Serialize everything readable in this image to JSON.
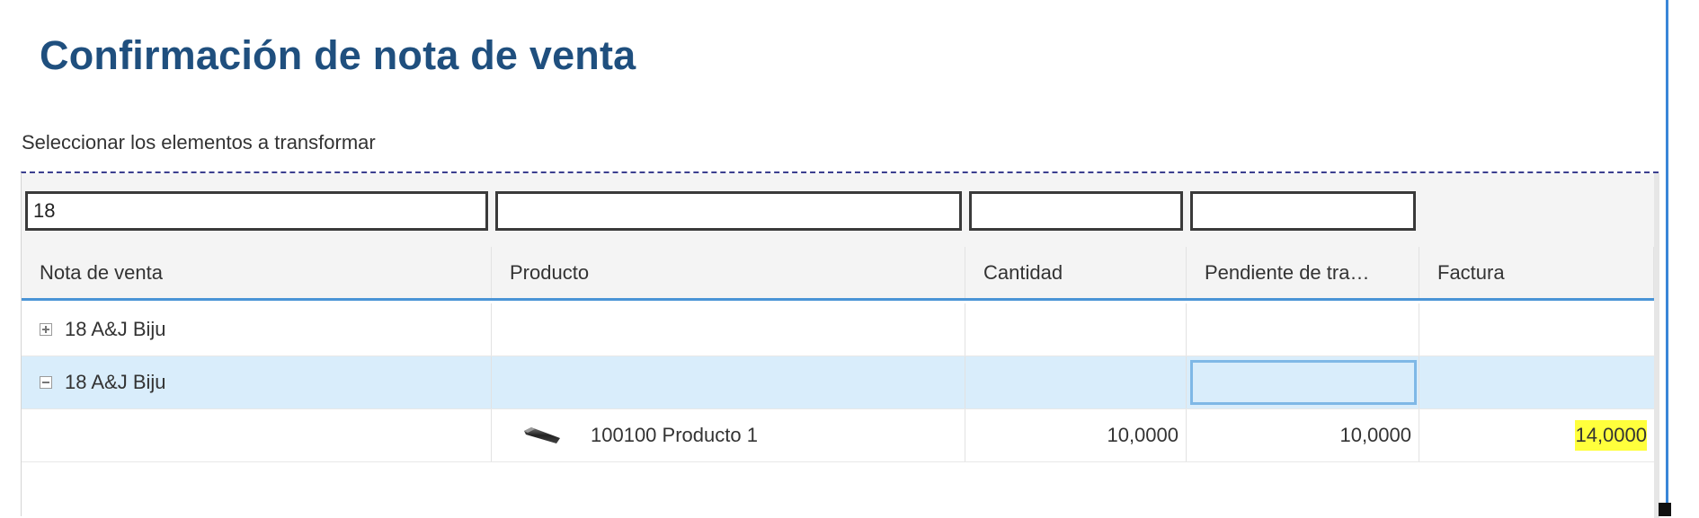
{
  "title": "Confirmación de nota de venta",
  "subtitle": "Seleccionar los elementos a transformar",
  "filters": {
    "nota_de_venta": "18",
    "producto": "",
    "cantidad": "",
    "pendiente": ""
  },
  "columns": [
    "Nota de venta",
    "Producto",
    "Cantidad",
    "Pendiente de tra…",
    "Factura"
  ],
  "rows": [
    {
      "expander": "plus",
      "nota": "18 A&J Biju"
    },
    {
      "expander": "minus",
      "nota": "18 A&J Biju",
      "selected": true
    },
    {
      "producto": "100100 Producto 1",
      "product_icon": "product-thumbnail-icon",
      "cantidad": "10,0000",
      "pendiente": "10,0000",
      "factura": "14,0000"
    }
  ],
  "colors": {
    "title": "#1f4f7e",
    "header_border": "#4a94d6",
    "selected_row": "#d9edfb",
    "highlight": "#ffff3c"
  }
}
